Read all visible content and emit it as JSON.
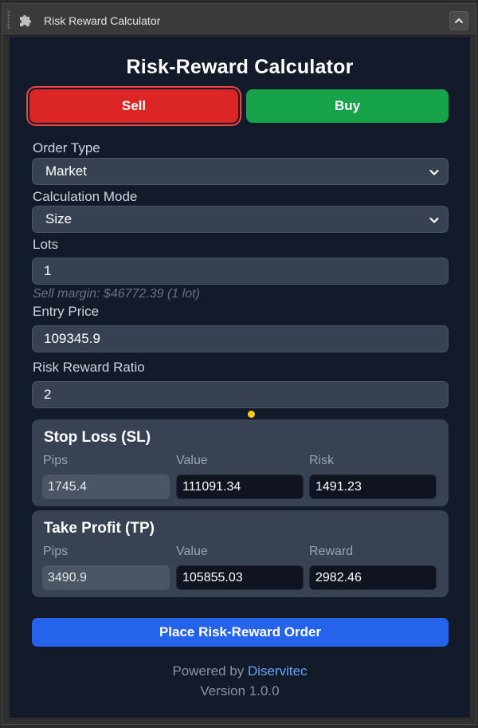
{
  "window": {
    "title": "Risk Reward Calculator"
  },
  "calculator": {
    "heading": "Risk-Reward Calculator",
    "sell_label": "Sell",
    "buy_label": "Buy",
    "order_type": {
      "label": "Order Type",
      "value": "Market"
    },
    "calc_mode": {
      "label": "Calculation Mode",
      "value": "Size"
    },
    "lots": {
      "label": "Lots",
      "value": "1",
      "hint": "Sell margin: $46772.39 (1 lot)"
    },
    "entry_price": {
      "label": "Entry Price",
      "value": "109345.9"
    },
    "rr_ratio": {
      "label": "Risk Reward Ratio",
      "value": "2"
    },
    "stop_loss": {
      "title": "Stop Loss (SL)",
      "pips_label": "Pips",
      "value_label": "Value",
      "risk_label": "Risk",
      "pips": "1745.4",
      "value": "111091.34",
      "risk": "1491.23"
    },
    "take_profit": {
      "title": "Take Profit (TP)",
      "pips_label": "Pips",
      "value_label": "Value",
      "reward_label": "Reward",
      "pips": "3490.9",
      "value": "105855.03",
      "reward": "2982.46"
    },
    "place_label": "Place Risk-Reward Order",
    "powered_prefix": "Powered by ",
    "powered_brand": "Diservitec",
    "version": "Version 1.0.0"
  },
  "colors": {
    "sell": "#dc2626",
    "buy": "#16a34a",
    "primary": "#2563eb",
    "panel": "#131a2a",
    "brand": "#60a5fa"
  }
}
